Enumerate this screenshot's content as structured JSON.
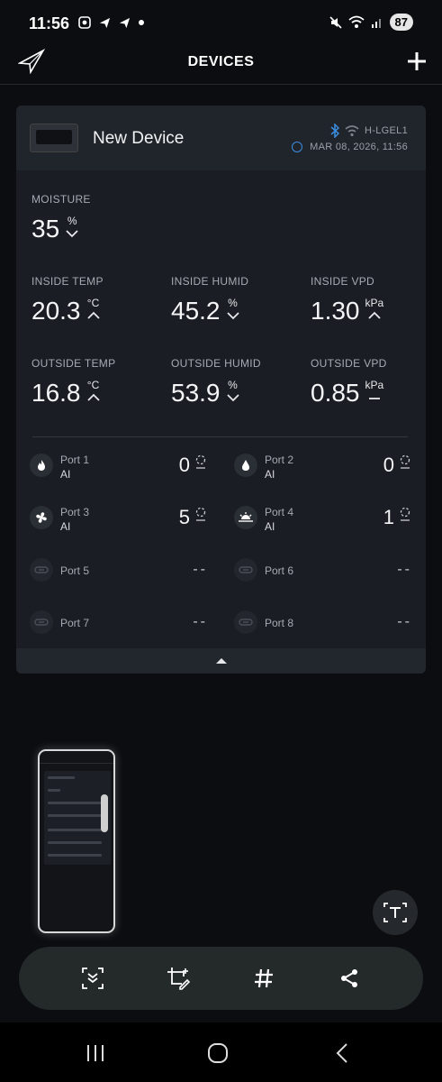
{
  "status_bar": {
    "time": "11:56",
    "battery": "87"
  },
  "header": {
    "title": "DEVICES"
  },
  "device": {
    "name": "New Device",
    "id": "H-LGEL1",
    "timestamp": "MAR 08, 2026, 11:56"
  },
  "metrics": {
    "moisture": {
      "label": "MOISTURE",
      "value": "35",
      "unit": "%",
      "trend": "down"
    },
    "inside_temp": {
      "label": "INSIDE TEMP",
      "value": "20.3",
      "unit": "°C",
      "trend": "up"
    },
    "inside_humid": {
      "label": "INSIDE HUMID",
      "value": "45.2",
      "unit": "%",
      "trend": "down"
    },
    "inside_vpd": {
      "label": "INSIDE VPD",
      "value": "1.30",
      "unit": "kPa",
      "trend": "up"
    },
    "outside_temp": {
      "label": "OUTSIDE TEMP",
      "value": "16.8",
      "unit": "°C",
      "trend": "up"
    },
    "outside_humid": {
      "label": "OUTSIDE HUMID",
      "value": "53.9",
      "unit": "%",
      "trend": "down"
    },
    "outside_vpd": {
      "label": "OUTSIDE VPD",
      "value": "0.85",
      "unit": "kPa",
      "trend": "flat"
    }
  },
  "ports": [
    {
      "name": "Port 1",
      "mode": "AI",
      "value": "0",
      "icon": "flame-icon"
    },
    {
      "name": "Port 2",
      "mode": "AI",
      "value": "0",
      "icon": "water-drop-icon"
    },
    {
      "name": "Port 3",
      "mode": "AI",
      "value": "5",
      "icon": "fan-icon"
    },
    {
      "name": "Port 4",
      "mode": "AI",
      "value": "1",
      "icon": "grow-light-icon"
    },
    {
      "name": "Port 5",
      "mode": "",
      "value": "--",
      "icon": "unplugged-icon"
    },
    {
      "name": "Port 6",
      "mode": "",
      "value": "--",
      "icon": "unplugged-icon"
    },
    {
      "name": "Port 7",
      "mode": "",
      "value": "--",
      "icon": "unplugged-icon"
    },
    {
      "name": "Port 8",
      "mode": "",
      "value": "--",
      "icon": "unplugged-icon"
    }
  ],
  "colors": {
    "accent_blue": "#3a8de0",
    "card_bg": "#1a1d23",
    "page_bg": "#0c0d10"
  }
}
